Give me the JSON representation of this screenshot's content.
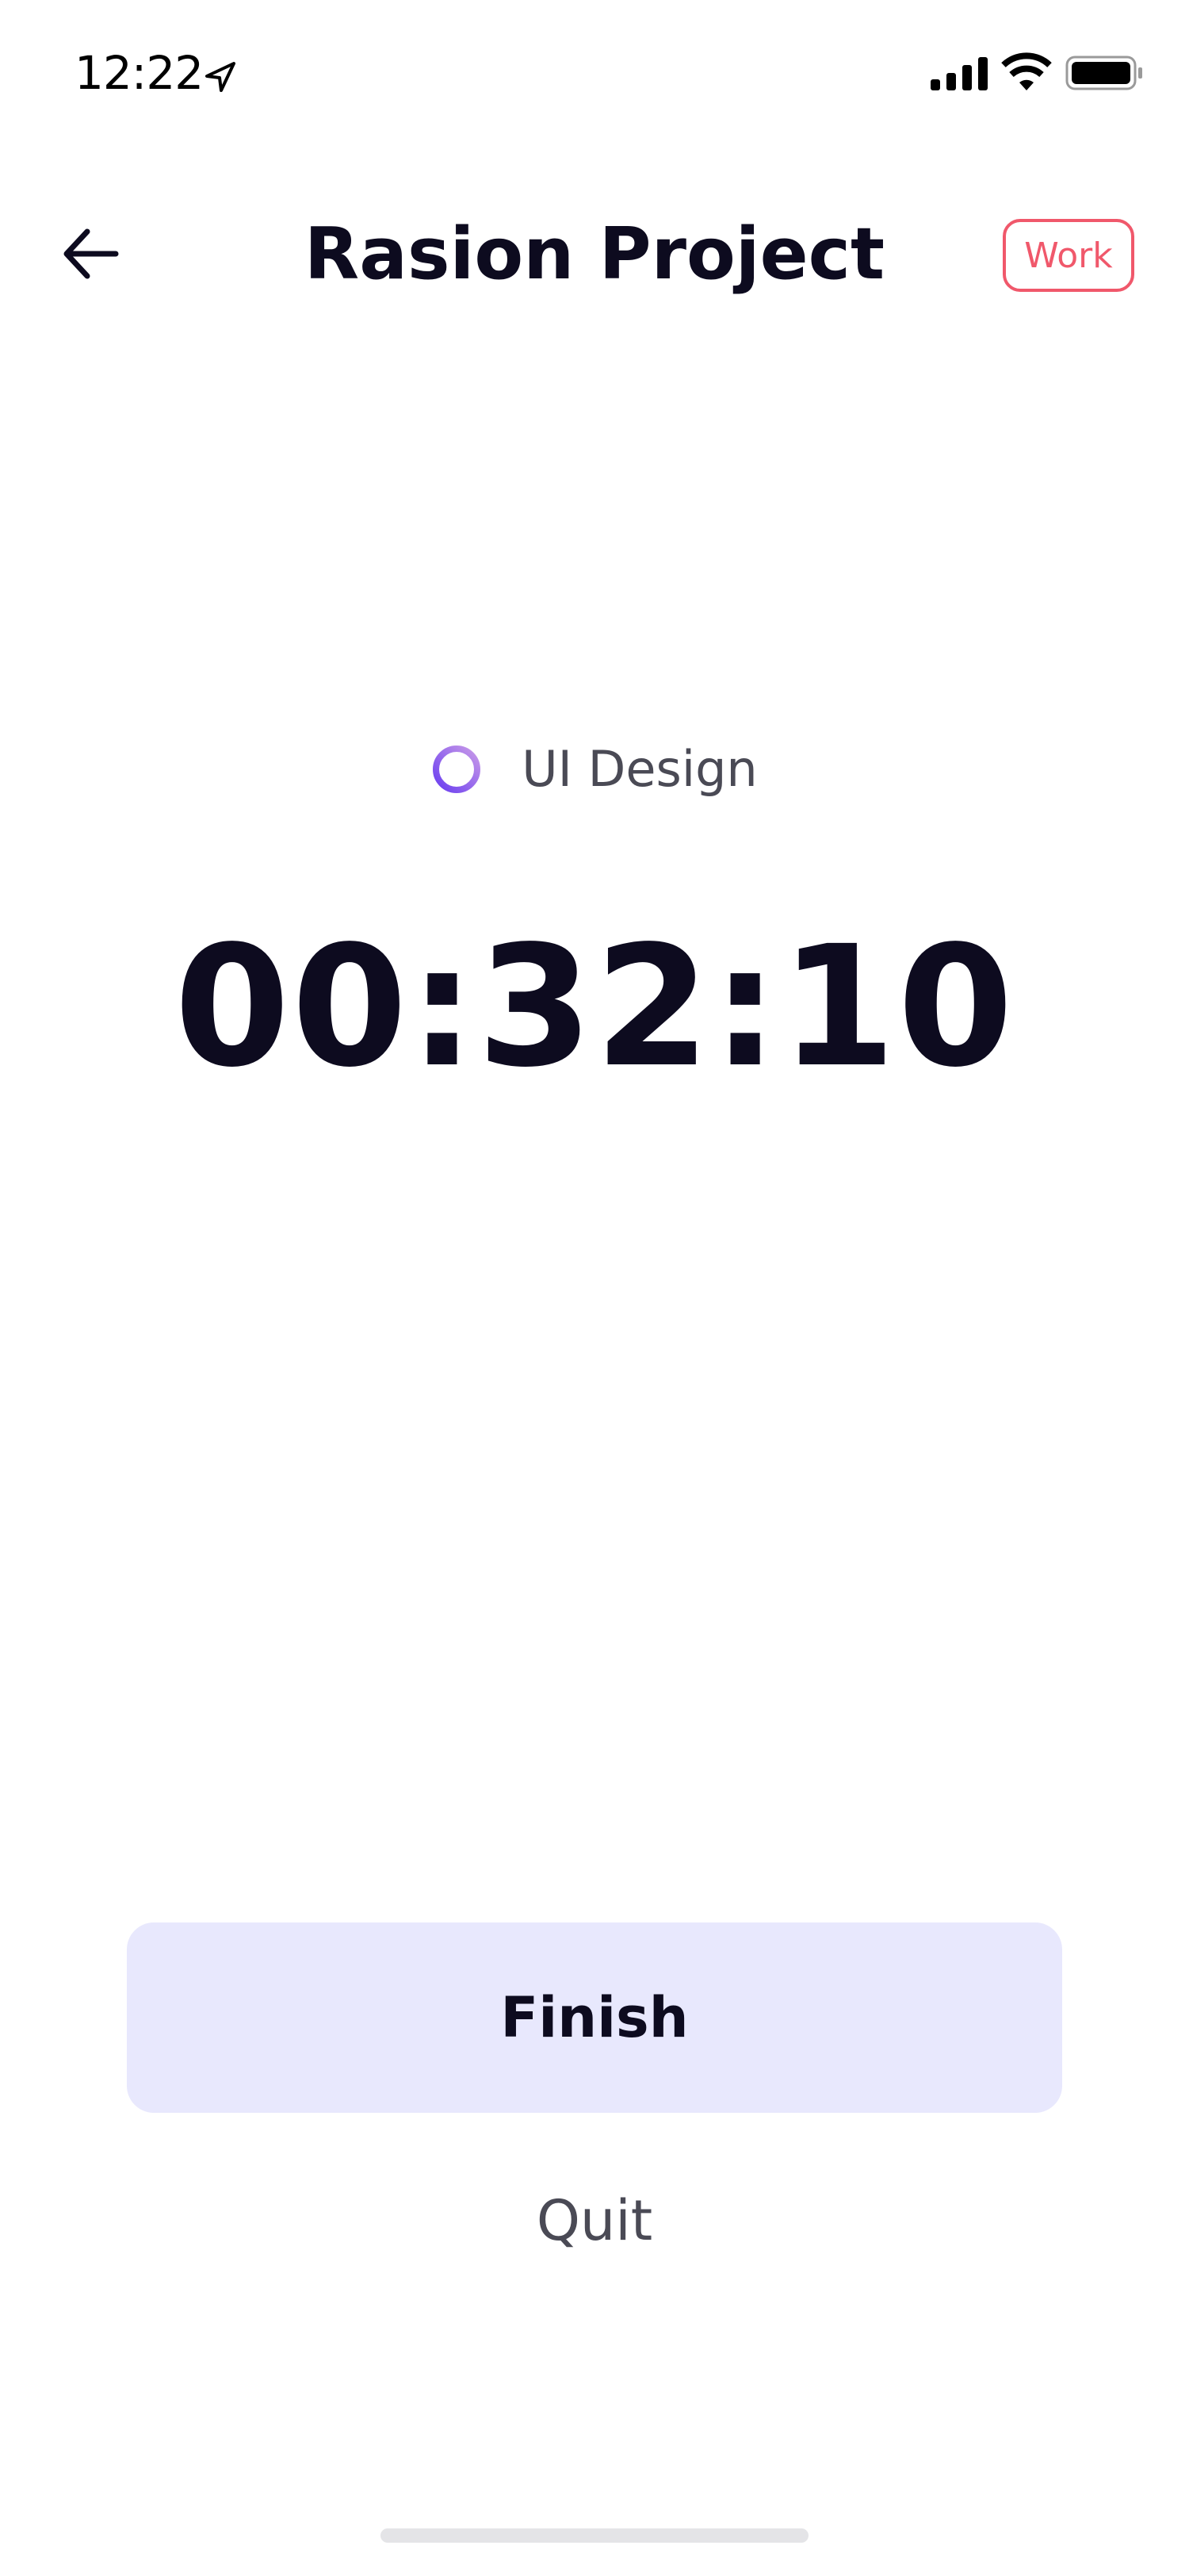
{
  "status_bar": {
    "time": "12:22",
    "icons": [
      "location-arrow-icon",
      "cellular-signal-icon",
      "wifi-icon",
      "battery-icon"
    ]
  },
  "header": {
    "back_icon": "arrow-left-icon",
    "title": "Rasion Project",
    "badge": "Work",
    "badge_color": "#f0586b"
  },
  "task": {
    "icon": "ring-icon",
    "label": "UI Design",
    "ring_colors": [
      "#6a3ef0",
      "#b07be8"
    ]
  },
  "timer": {
    "value": "00:32:10"
  },
  "actions": {
    "finish_label": "Finish",
    "quit_label": "Quit",
    "finish_bg": "#e8e8fd"
  }
}
